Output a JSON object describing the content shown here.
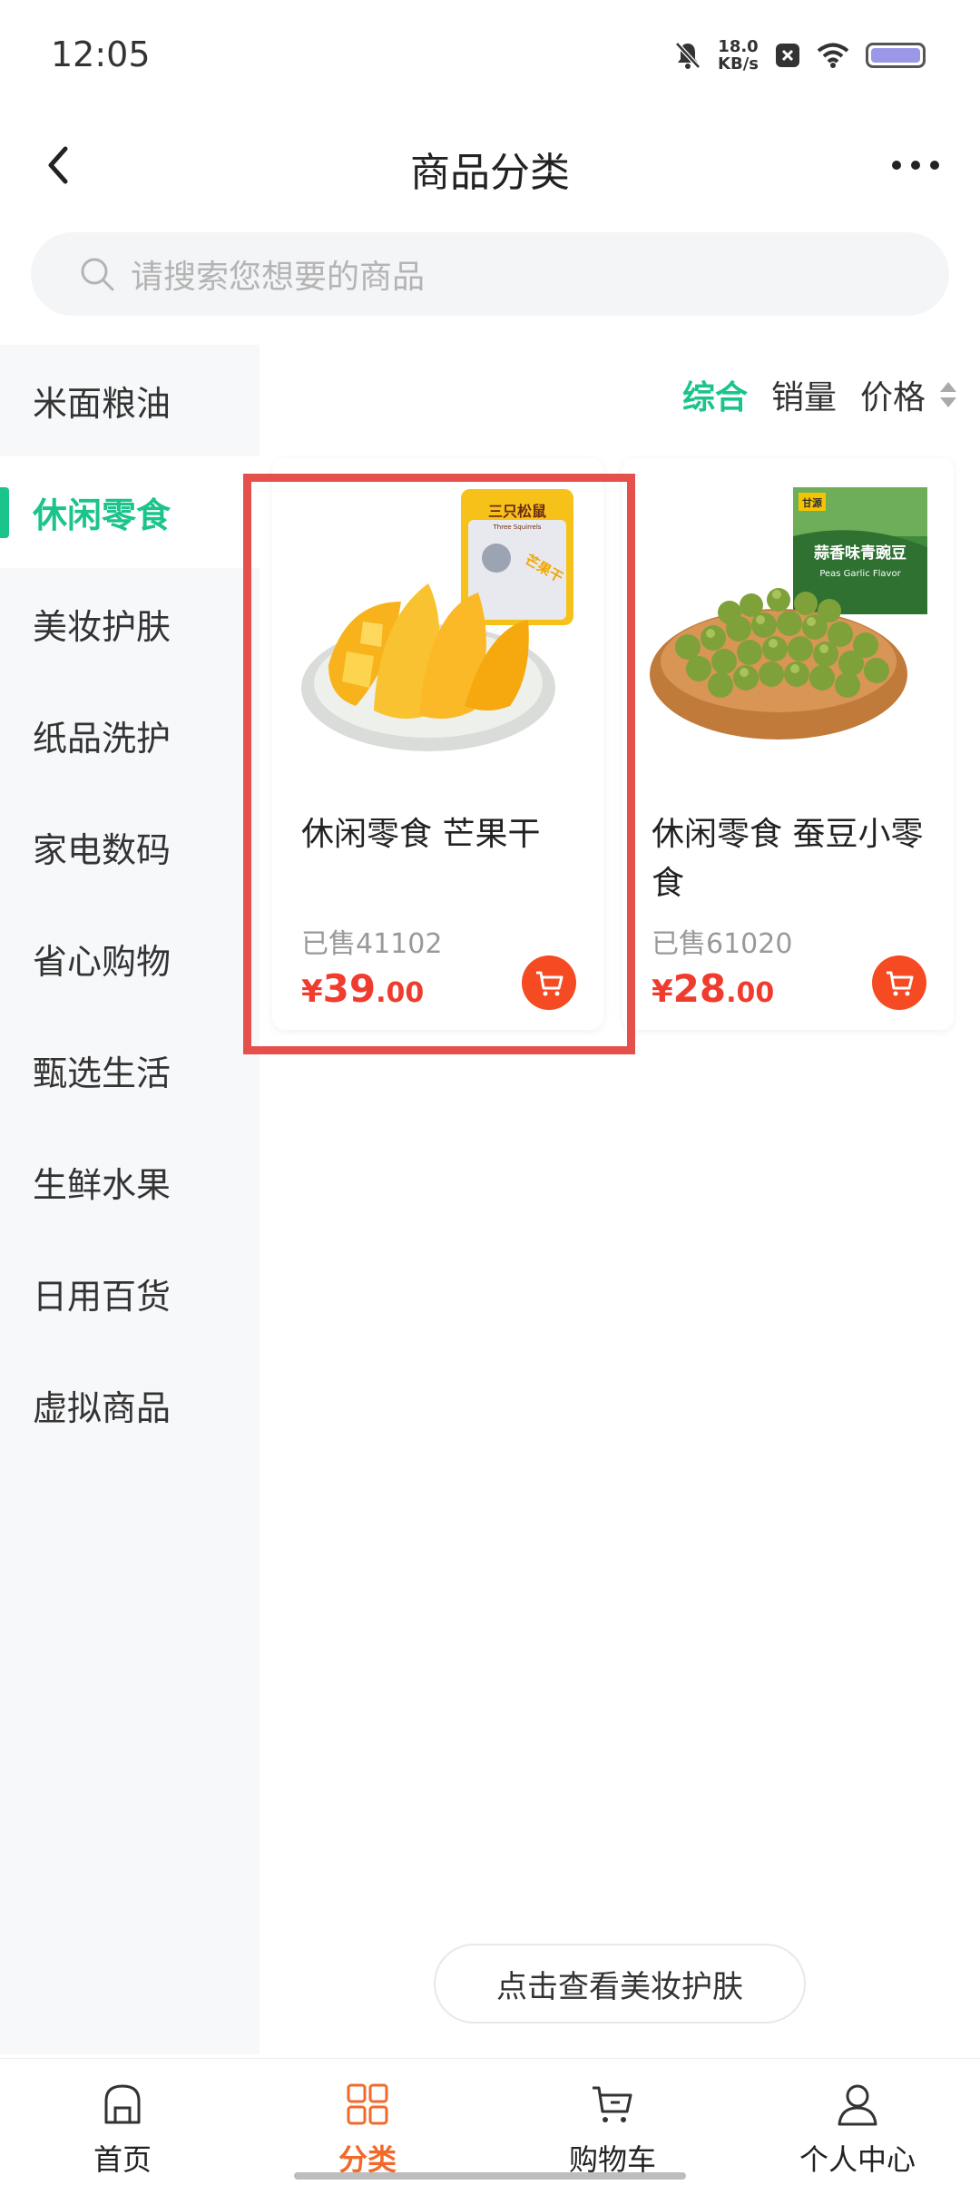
{
  "status_bar": {
    "time": "12:05",
    "net_speed": "18.0",
    "net_unit": "KB/s",
    "icons": [
      "mute-icon",
      "net-speed",
      "close-box-icon",
      "wifi-icon",
      "battery-icon"
    ],
    "battery_color": "#9b98e8"
  },
  "nav": {
    "title": "商品分类"
  },
  "search": {
    "placeholder": "请搜索您想要的商品"
  },
  "sidebar": {
    "items": [
      {
        "label": "米面粮油",
        "active": false
      },
      {
        "label": "休闲零食",
        "active": true
      },
      {
        "label": "美妆护肤",
        "active": false
      },
      {
        "label": "纸品洗护",
        "active": false
      },
      {
        "label": "家电数码",
        "active": false
      },
      {
        "label": "省心购物",
        "active": false
      },
      {
        "label": "甄选生活",
        "active": false
      },
      {
        "label": "生鲜水果",
        "active": false
      },
      {
        "label": "日用百货",
        "active": false
      },
      {
        "label": "虚拟商品",
        "active": false
      }
    ]
  },
  "sort": {
    "options": [
      "综合",
      "销量",
      "价格"
    ],
    "active": "综合"
  },
  "products": [
    {
      "name": "休闲零食 芒果干",
      "sold": "已售41102",
      "currency": "¥",
      "price_int": "39",
      "price_dec": ".00",
      "package_brand": "三只松鼠",
      "package_sub": "Three Squirrels",
      "package_stamp": "芒果干"
    },
    {
      "name": "休闲零食 蚕豆小零食",
      "sold": "已售61020",
      "currency": "¥",
      "price_int": "28",
      "price_dec": ".00",
      "package_brand": "甘源",
      "package_title": "蒜香味青豌豆",
      "package_sub": "Peas Garlic Flavor"
    }
  ],
  "view_more": "点击查看美妆护肤",
  "tabbar": {
    "tabs": [
      {
        "label": "首页",
        "icon": "home-icon",
        "active": false
      },
      {
        "label": "分类",
        "icon": "category-grid-icon",
        "active": true
      },
      {
        "label": "购物车",
        "icon": "cart-icon",
        "active": false
      },
      {
        "label": "个人中心",
        "icon": "user-icon",
        "active": false
      }
    ]
  },
  "colors": {
    "accent_green": "#1bc48a",
    "price_red": "#f03c2e",
    "cart_orange": "#f54a22",
    "tab_active": "#f26a2b",
    "highlight_red": "#e5504c"
  }
}
